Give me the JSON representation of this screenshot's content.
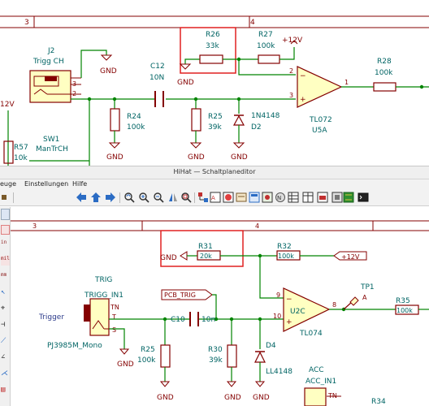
{
  "window": {
    "title": "HiHat — Schaltplaneditor"
  },
  "menu": {
    "items": [
      "euge",
      "Einstellungen",
      "Hilfe"
    ]
  },
  "top_schematic": {
    "frame": {
      "col3": "3",
      "col4": "4"
    },
    "j2": {
      "ref": "J2",
      "value": "Trigg CH",
      "pin3": "3",
      "pin2": "2"
    },
    "r26": {
      "ref": "R26",
      "value": "33k"
    },
    "r27": {
      "ref": "R27",
      "value": "100k"
    },
    "power_12v": "+12V",
    "power_12v_left": "12V",
    "gnd": "GND",
    "c12": {
      "ref": "C12",
      "value": "10N"
    },
    "r24": {
      "ref": "R24",
      "value": "100k"
    },
    "r25": {
      "ref": "R25",
      "value": "39k"
    },
    "d2": {
      "ref": "D2",
      "value": "1N4148"
    },
    "u5a": {
      "ref": "U5A",
      "value": "TL072",
      "pin2": "2",
      "pin3": "3",
      "pin1": "1",
      "minus": "−",
      "plus": "+"
    },
    "r28": {
      "ref": "R28",
      "value": "100k"
    },
    "sw1": {
      "ref": "SW1",
      "value": "ManTrCH"
    },
    "r57": {
      "ref": "R57",
      "value": "10k"
    }
  },
  "bottom_schematic": {
    "frame": {
      "col3": "3",
      "col4": "4"
    },
    "r31": {
      "ref": "R31",
      "value": "20k"
    },
    "r32": {
      "ref": "R32",
      "value": "100k"
    },
    "gnd_label": "GND",
    "power_12v": "+12V",
    "trig": {
      "title": "TRIG",
      "ref": "TRIGG_IN1",
      "value": "PJ3985M_Mono",
      "pin_tn": "TN",
      "pin_t": "T",
      "pin_s": "S"
    },
    "trigger_label": "Trigger",
    "pcb_trig": "PCB_TRIG",
    "c10": {
      "ref": "C10",
      "value": "10n"
    },
    "r25": {
      "ref": "R25",
      "value": "100k"
    },
    "r30": {
      "ref": "R30",
      "value": "39k"
    },
    "d4": {
      "ref": "D4",
      "value": "LL4148"
    },
    "u2c": {
      "ref": "U2C",
      "value": "TL074",
      "pin9": "9",
      "pin10": "10",
      "pin8": "8",
      "minus": "−",
      "plus": "+"
    },
    "tp1": {
      "ref": "TP1",
      "pin": "A"
    },
    "r35": {
      "ref": "R35",
      "value": "100k"
    },
    "acc": {
      "title": "ACC",
      "ref": "ACC_IN1",
      "pin_tn": "TN"
    },
    "r34": {
      "ref": "R34"
    },
    "gnd": "GND"
  },
  "left_toolbar": {
    "labels": [
      "in",
      "mil",
      "mm"
    ]
  },
  "colors": {
    "wire": "#008400",
    "component": "#840000",
    "ref_text": "#006464",
    "value_text": "#006464",
    "highlight": "#e02020",
    "junction": "#008400",
    "frame": "#840000"
  }
}
